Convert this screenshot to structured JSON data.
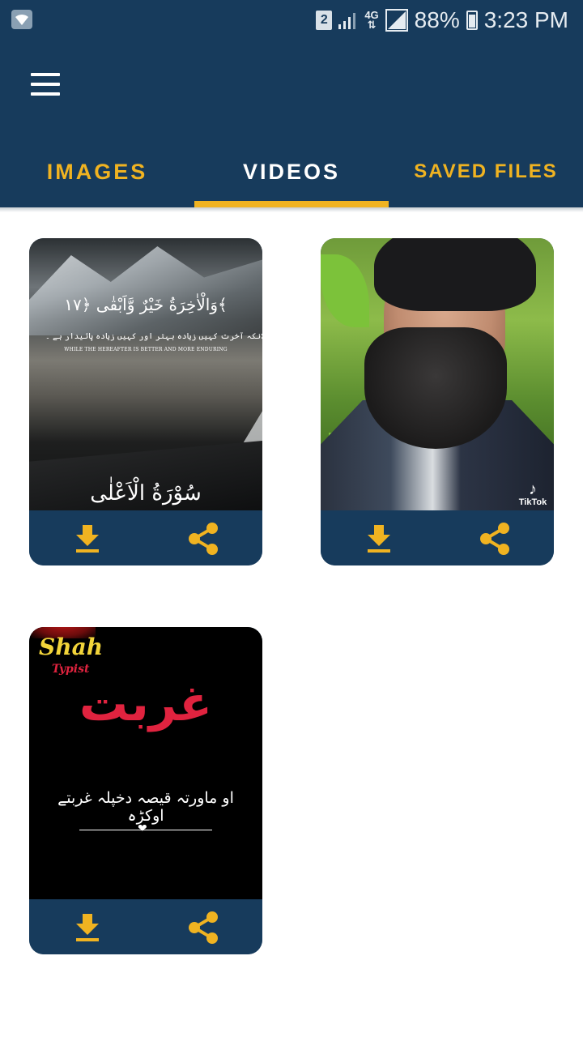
{
  "status_bar": {
    "sim_number": "2",
    "network": "4G",
    "battery": "88%",
    "time": "3:23 PM"
  },
  "app_bar": {
    "menu_icon": "hamburger-menu-icon",
    "tabs": [
      {
        "label": "IMAGES",
        "active": false
      },
      {
        "label": "VIDEOS",
        "active": true
      },
      {
        "label": "SAVED FILES",
        "active": false
      }
    ]
  },
  "colors": {
    "primary": "#173b5c",
    "accent": "#f0b321",
    "active_tab_text": "#ffffff"
  },
  "videos": [
    {
      "overlay_lines": [
        "وَالْاٰخِرَةُ خَيْرٌ وَّاَبْقٰى ﴿۱۷﴾",
        "حالانکہ آخرت کہیں زیادہ بہتر اور کہیں زیادہ پائیدار ہے ۔",
        "WHILE THE HEREAFTER IS BETTER AND MORE ENDURING",
        "سُوْرَةُ الْاَعْلٰى"
      ],
      "download_icon": "download-icon",
      "share_icon": "share-icon"
    },
    {
      "watermark": "TikTok",
      "download_icon": "download-icon",
      "share_icon": "share-icon"
    },
    {
      "brand_name": "Shah",
      "brand_sub": "Typist",
      "title": "غربت",
      "line": "او ماورتہ قیصہ دخپلہ غربتے اوکڑہ",
      "download_icon": "download-icon",
      "share_icon": "share-icon"
    }
  ]
}
